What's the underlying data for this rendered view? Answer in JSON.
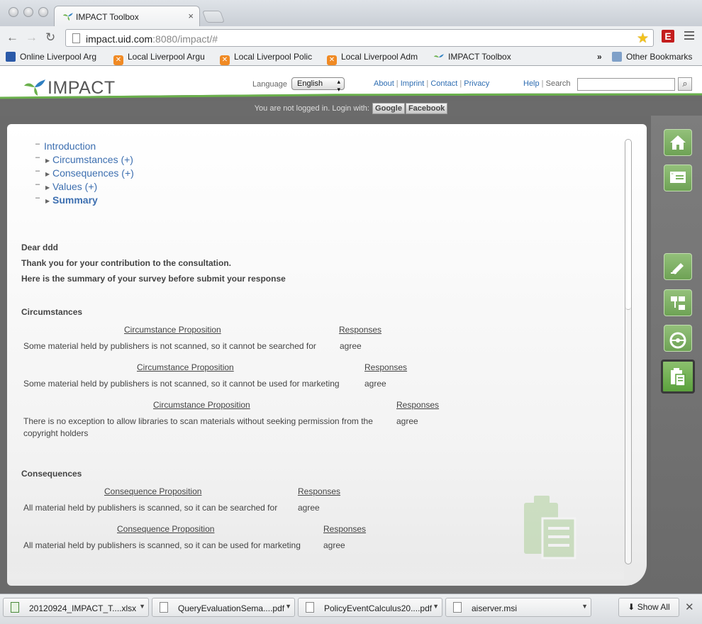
{
  "browser": {
    "tab_title": "IMPACT Toolbox",
    "url_host": "impact.uid.com",
    "url_rest": ":8080/impact/#",
    "ext_badge": "E",
    "bookmarks": [
      "Online Liverpool Arg",
      "Local Liverpool Argu",
      "Local Liverpool Polic",
      "Local Liverpool Adm",
      "IMPACT Toolbox"
    ],
    "bookmarks_more": "»",
    "other_bookmarks": "Other Bookmarks"
  },
  "header": {
    "logo": "IMPACT",
    "language_label": "Language",
    "language_value": "English",
    "links": [
      "About",
      "Imprint",
      "Contact",
      "Privacy"
    ],
    "help": "Help",
    "search_label": "Search",
    "login_text": "You are not logged in. Login with:",
    "login_google": "Google",
    "login_facebook": "Facebook"
  },
  "nav": {
    "items": [
      {
        "label": "Introduction"
      },
      {
        "label": "Circumstances (+)"
      },
      {
        "label": "Consequences (+)"
      },
      {
        "label": "Values (+)"
      },
      {
        "label": "Summary"
      }
    ]
  },
  "summary": {
    "greeting": "Dear ddd",
    "thanks": "Thank you for your contribution to the consultation.",
    "intro": "Here is the summary of your survey before submit your response",
    "circumstances_heading": "Circumstances",
    "consequences_heading": "Consequences",
    "circumstance_col": "Circumstance Proposition",
    "consequence_col": "Consequence Proposition",
    "responses_col": "Responses",
    "circumstances": [
      {
        "proposition": "Some material held by publishers is not scanned, so it cannot be searched for",
        "response": "agree"
      },
      {
        "proposition": "Some material held by publishers is not scanned, so it cannot be used for marketing",
        "response": "agree"
      },
      {
        "proposition": "There is no exception to allow libraries to scan materials without seeking permission from the copyright holders",
        "response": "agree"
      }
    ],
    "consequences": [
      {
        "proposition": "All material held by publishers is scanned, so it can be searched for",
        "response": "agree"
      },
      {
        "proposition": "All material held by publishers is scanned, so it can be used for marketing",
        "response": "agree"
      }
    ]
  },
  "downloads": {
    "items": [
      "20120924_IMPACT_T....xlsx",
      "QueryEvaluationSema....pdf",
      "PolicyEventCalculus20....pdf",
      "aiserver.msi"
    ],
    "show_all": "Show All"
  }
}
